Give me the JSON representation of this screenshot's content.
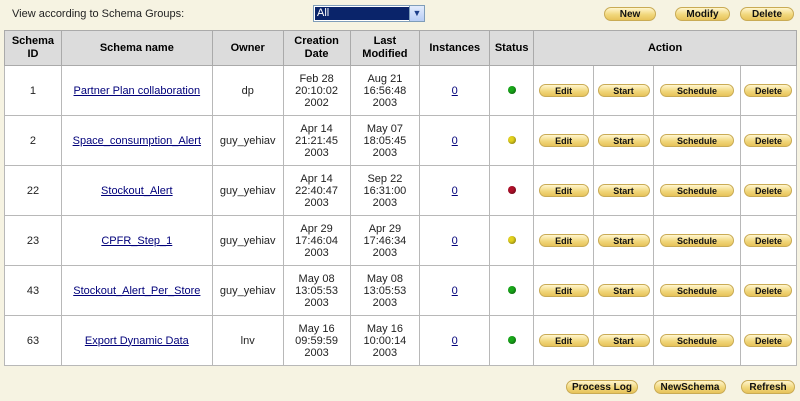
{
  "toolbar": {
    "filter_label": "View according to Schema Groups:",
    "group_value": "All",
    "new_label": "New",
    "modify_label": "Modify",
    "delete_label": "Delete"
  },
  "table": {
    "columns": [
      "Schema ID",
      "Schema name",
      "Owner",
      "Creation Date",
      "Last Modified",
      "Instances",
      "Status",
      "Action"
    ],
    "action_labels": [
      "Edit",
      "Start",
      "Schedule",
      "Delete"
    ],
    "status_colors": {
      "green": "#19a81a",
      "yellow": "#e3d21e",
      "red": "#b0102a"
    },
    "rows": [
      {
        "id": "1",
        "name": "Partner Plan collaboration",
        "owner": "dp",
        "created": [
          "Feb 28",
          "20:10:02",
          "2002"
        ],
        "modified": [
          "Aug 21",
          "16:56:48",
          "2003"
        ],
        "instances": "0",
        "status": "green"
      },
      {
        "id": "2",
        "name": "Space_consumption_Alert",
        "owner": "guy_yehiav",
        "created": [
          "Apr 14",
          "21:21:45",
          "2003"
        ],
        "modified": [
          "May 07",
          "18:05:45",
          "2003"
        ],
        "instances": "0",
        "status": "yellow"
      },
      {
        "id": "22",
        "name": "Stockout_Alert",
        "owner": "guy_yehiav",
        "created": [
          "Apr 14",
          "22:40:47",
          "2003"
        ],
        "modified": [
          "Sep 22",
          "16:31:00",
          "2003"
        ],
        "instances": "0",
        "status": "red"
      },
      {
        "id": "23",
        "name": "CPFR_Step_1",
        "owner": "guy_yehiav",
        "created": [
          "Apr 29",
          "17:46:04",
          "2003"
        ],
        "modified": [
          "Apr 29",
          "17:46:34",
          "2003"
        ],
        "instances": "0",
        "status": "yellow"
      },
      {
        "id": "43",
        "name": "Stockout_Alert_Per_Store",
        "owner": "guy_yehiav",
        "created": [
          "May 08",
          "13:05:53",
          "2003"
        ],
        "modified": [
          "May 08",
          "13:05:53",
          "2003"
        ],
        "instances": "0",
        "status": "green"
      },
      {
        "id": "63",
        "name": "Export Dynamic Data",
        "owner": "lnv",
        "created": [
          "May 16",
          "09:59:59",
          "2003"
        ],
        "modified": [
          "May 16",
          "10:00:14",
          "2003"
        ],
        "instances": "0",
        "status": "green"
      }
    ]
  },
  "footer": {
    "process_log_label": "Process Log",
    "new_schema_label": "NewSchema",
    "refresh_label": "Refresh"
  }
}
